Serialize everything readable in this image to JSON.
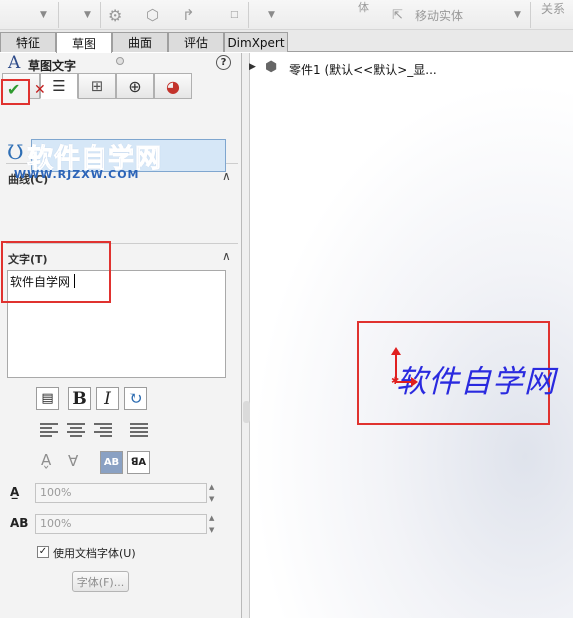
{
  "toolbar": {
    "move_entity_label": "移动实体",
    "relations_label": "关系"
  },
  "tabs": [
    "特征",
    "草图",
    "曲面",
    "评估",
    "DimXpert"
  ],
  "panel": {
    "title": "草图文字",
    "help": "?",
    "curves_section": "曲线(C)",
    "text_section": "文字(T)",
    "text_value": "软件自学网",
    "width_factor": "100%",
    "spacing": "100%",
    "use_doc_font_label": "使用文档字体(U)",
    "use_doc_font_checked": true,
    "font_button_label": "字体(F)...",
    "bold_label": "B",
    "italic_label": "I",
    "ab_label_1": "AB",
    "ab_label_2": "ꓭA"
  },
  "watermark": {
    "main": "软件自学网",
    "url": "WWW.RJZXW.COM"
  },
  "tree": {
    "root_label": "零件1  (默认<<默认>_显..."
  },
  "viewport": {
    "sketch_text": "软件自学网"
  },
  "colors": {
    "highlight_box": "#e0322f",
    "sketch_text": "#2a2adf",
    "accept": "#2f9a2f",
    "cancel": "#c41d1d"
  }
}
